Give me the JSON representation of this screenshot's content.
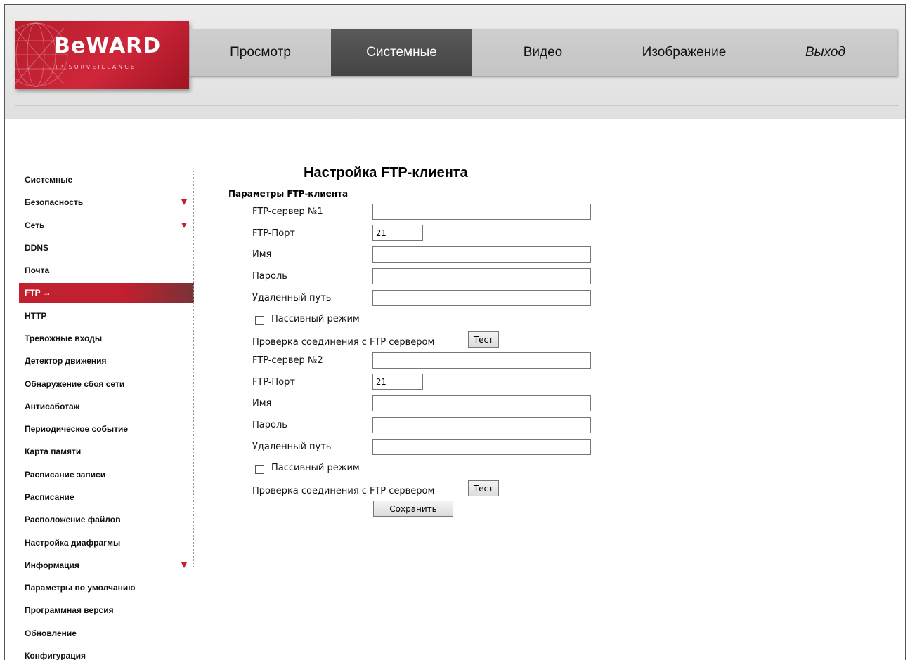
{
  "logo": {
    "brand": "BeWARD",
    "tagline": "IP SURVEILLANCE"
  },
  "nav": [
    {
      "label": "Просмотр",
      "active": false
    },
    {
      "label": "Системные",
      "active": true
    },
    {
      "label": "Видео",
      "active": false
    },
    {
      "label": "Изображение",
      "active": false
    },
    {
      "label": "Выход",
      "active": false
    }
  ],
  "sidebar": {
    "items": [
      {
        "label": "Системные"
      },
      {
        "label": "Безопасность",
        "expandable": true
      },
      {
        "label": "Сеть",
        "expandable": true
      },
      {
        "label": "DDNS"
      },
      {
        "label": "Почта"
      },
      {
        "label": "FTP →",
        "active": true
      },
      {
        "label": "HTTP"
      },
      {
        "label": "Тревожные входы"
      },
      {
        "label": "Детектор движения"
      },
      {
        "label": "Обнаружение сбоя сети"
      },
      {
        "label": "Антисаботаж"
      },
      {
        "label": "Периодическое событие"
      },
      {
        "label": "Карта памяти"
      },
      {
        "label": "Расписание записи"
      },
      {
        "label": "Расписание"
      },
      {
        "label": "Расположение файлов"
      },
      {
        "label": "Настройка диафрагмы"
      },
      {
        "label": "Информация",
        "expandable": true
      },
      {
        "label": "Параметры по умолчанию"
      },
      {
        "label": "Программная версия"
      },
      {
        "label": "Обновление"
      },
      {
        "label": "Конфигурация"
      }
    ]
  },
  "main": {
    "title": "Настройка FTP-клиента",
    "section": "Параметры FTP-клиента",
    "server1": {
      "server_label": "FTP-сервер №1",
      "server_value": "",
      "port_label": "FTP-Порт",
      "port_value": "21",
      "name_label": "Имя",
      "name_value": "",
      "password_label": "Пароль",
      "password_value": "",
      "path_label": "Удаленный путь",
      "path_value": "",
      "passive_label": "Пассивный режим",
      "passive_checked": false,
      "test_label": "Проверка соединения с FTP сервером",
      "test_button": "Тест"
    },
    "server2": {
      "server_label": "FTP-сервер №2",
      "server_value": "",
      "port_label": "FTP-Порт",
      "port_value": "21",
      "name_label": "Имя",
      "name_value": "",
      "password_label": "Пароль",
      "password_value": "",
      "path_label": "Удаленный путь",
      "path_value": "",
      "passive_label": "Пассивный режим",
      "passive_checked": false,
      "test_label": "Проверка соединения с FTP сервером",
      "test_button": "Тест"
    },
    "save_button": "Сохранить"
  },
  "colors": {
    "accent": "#c0202f",
    "nav_active": "#4e4e4e",
    "header_bg": "#e6e6e6"
  }
}
